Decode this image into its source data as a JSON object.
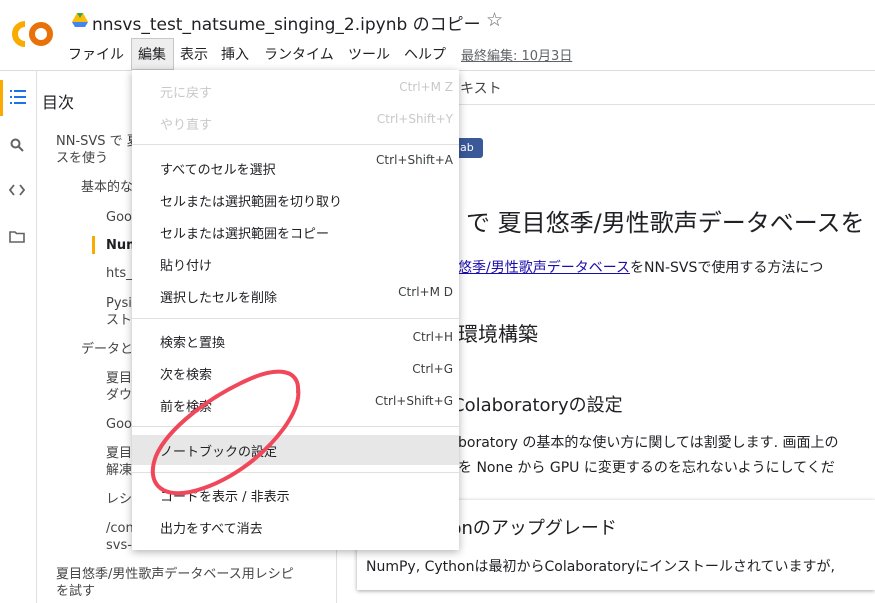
{
  "header": {
    "title": "nnsvs_test_natsume_singing_2.ipynb のコピー",
    "logo_text": "CO",
    "star": "☆",
    "menus": [
      "ファイル",
      "編集",
      "表示",
      "挿入",
      "ランタイム",
      "ツール",
      "ヘルプ"
    ],
    "last_edit": "最終編集: 10月3日"
  },
  "toc": {
    "title": "目次",
    "items": [
      "NN-SVS で 夏",
      "スを使う",
      "基本的な",
      "Goo",
      "Num",
      "hts_",
      "Pysi",
      "スト",
      "データと",
      "夏目",
      "ダウ",
      "Goo",
      "夏目",
      "解凍",
      "レシ",
      "/con",
      "svs-",
      "夏目悠季/男性歌声データベース用レシピ",
      "を試す"
    ]
  },
  "notebook": {
    "tab": "キスト",
    "badge": "lab",
    "h1": "で 夏目悠季/男性歌声データベースを",
    "p_link": "悠季/男性歌声データベース",
    "p_rest": "をNN-SVSで使用する方法につ",
    "h2": "環境構築",
    "h3": "Colaboratoryの設定",
    "p1": "boratory の基本的な使い方に関しては割愛します. 画面上の",
    "p2": "を None から GPU に変更するのを忘れないようにしてくだ",
    "h3b": "thonのアップグレード",
    "cell_text": "NumPy, Cythonは最初からColaboratoryにインストールされていますが,"
  },
  "dropdown": {
    "items": [
      {
        "label": "元に戻す",
        "shortcut": "Ctrl+M Z"
      },
      {
        "label": "やり直す",
        "shortcut": "Ctrl+Shift+Y"
      },
      {
        "label": "すべてのセルを選択",
        "shortcut": "Ctrl+Shift+A"
      },
      {
        "label": "セルまたは選択範囲を切り取り",
        "shortcut": ""
      },
      {
        "label": "セルまたは選択範囲をコピー",
        "shortcut": ""
      },
      {
        "label": "貼り付け",
        "shortcut": ""
      },
      {
        "label": "選択したセルを削除",
        "shortcut": "Ctrl+M D"
      },
      {
        "label": "検索と置換",
        "shortcut": "Ctrl+H"
      },
      {
        "label": "次を検索",
        "shortcut": "Ctrl+G"
      },
      {
        "label": "前を検索",
        "shortcut": "Ctrl+Shift+G"
      },
      {
        "label": "ノートブックの設定",
        "shortcut": ""
      },
      {
        "label": "コードを表示 / 非表示",
        "shortcut": ""
      },
      {
        "label": "出力をすべて消去",
        "shortcut": ""
      }
    ]
  },
  "colors": {
    "accent_yellow": "#f9ab00",
    "logo_orange": "#f9ab00",
    "annotation_red": "#f0485a",
    "link_blue": "#1a0dab"
  }
}
